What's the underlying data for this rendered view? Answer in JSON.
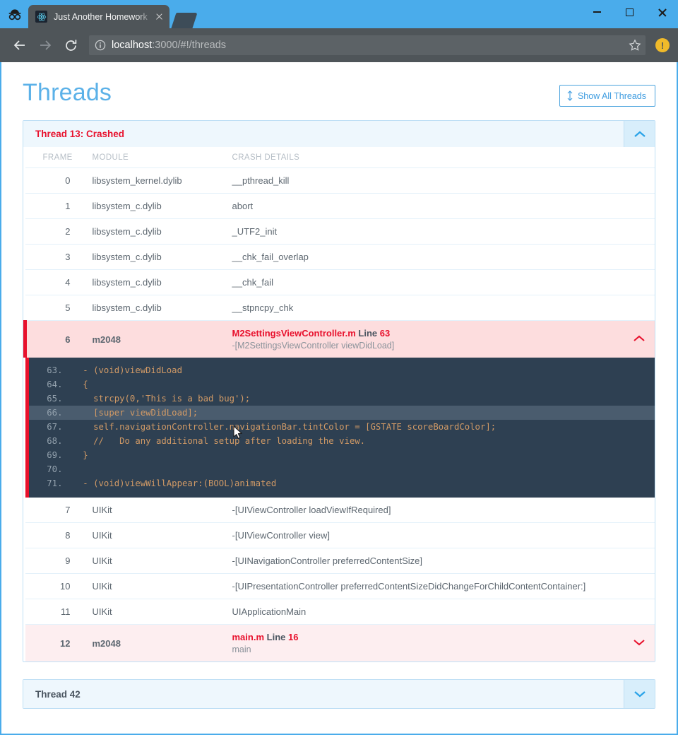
{
  "browser": {
    "incognito_icon": "incognito-hat-icon",
    "tab": {
      "title": "Just Another Homework",
      "favicon": "react-logo-icon",
      "close_icon": "close-icon"
    },
    "new_tab_icon": "new-tab-icon",
    "window_controls": {
      "minimize": "minimize-icon",
      "maximize": "maximize-icon",
      "close": "close-icon"
    },
    "toolbar": {
      "back_icon": "back-arrow-icon",
      "forward_icon": "forward-arrow-icon",
      "reload_icon": "reload-icon",
      "info_icon": "page-info-icon",
      "url_host": "localhost",
      "url_rest": ":3000/#!/threads",
      "bookmark_icon": "star-icon",
      "menu_badge_icon": "update-alert-icon",
      "menu_badge_glyph": "!"
    }
  },
  "page": {
    "title": "Threads",
    "show_all_button": {
      "label": "Show All Threads",
      "icon": "up-down-arrow-icon"
    }
  },
  "threads": [
    {
      "header": "Thread 13: Crashed",
      "crashed": true,
      "expanded": true,
      "toggle_icon": "chevron-up-icon",
      "columns": {
        "frame": "FRAME",
        "module": "MODULE",
        "details": "CRASH DETAILS"
      },
      "frames": [
        {
          "frame": "0",
          "module": "libsystem_kernel.dylib",
          "details": "__pthread_kill"
        },
        {
          "frame": "1",
          "module": "libsystem_c.dylib",
          "details": "abort"
        },
        {
          "frame": "2",
          "module": "libsystem_c.dylib",
          "details": "_UTF2_init"
        },
        {
          "frame": "3",
          "module": "libsystem_c.dylib",
          "details": "__chk_fail_overlap"
        },
        {
          "frame": "4",
          "module": "libsystem_c.dylib",
          "details": "__chk_fail"
        },
        {
          "frame": "5",
          "module": "libsystem_c.dylib",
          "details": "__stpncpy_chk"
        },
        {
          "frame": "6",
          "module": "m2048",
          "highlight": "crash",
          "file": "M2SettingsViewController.m",
          "line_label": "Line",
          "line_num": "63",
          "symbol": "-[M2SettingsViewController viewDidLoad]",
          "toggle_icon": "chevron-up-icon",
          "code": {
            "highlight_line": "66",
            "lines": [
              {
                "num": "63.",
                "text": "  - (void)viewDidLoad"
              },
              {
                "num": "64.",
                "text": "  {"
              },
              {
                "num": "65.",
                "text": "    strcpy(0,'This is a bad bug');"
              },
              {
                "num": "66.",
                "text": "    [super viewDidLoad];"
              },
              {
                "num": "67.",
                "text": "    self.navigationController.navigationBar.tintColor = [GSTATE scoreBoardColor];"
              },
              {
                "num": "68.",
                "text": "    //   Do any additional setup after loading the view."
              },
              {
                "num": "69.",
                "text": "  }"
              },
              {
                "num": "70.",
                "text": ""
              },
              {
                "num": "71.",
                "text": "  - (void)viewWillAppear:(BOOL)animated"
              }
            ]
          }
        },
        {
          "frame": "7",
          "module": "UIKit",
          "details": "-[UIViewController loadViewIfRequired]"
        },
        {
          "frame": "8",
          "module": "UIKit",
          "details": "-[UIViewController view]"
        },
        {
          "frame": "9",
          "module": "UIKit",
          "details": "-[UINavigationController preferredContentSize]"
        },
        {
          "frame": "10",
          "module": "UIKit",
          "details": "-[UIPresentationController preferredContentSizeDidChangeForChildContentContainer:]"
        },
        {
          "frame": "11",
          "module": "UIKit",
          "details": "UIApplicationMain"
        },
        {
          "frame": "12",
          "module": "m2048",
          "highlight": "crash-last",
          "file": "main.m",
          "line_label": "Line",
          "line_num": "16",
          "symbol": "main",
          "toggle_icon": "chevron-down-icon"
        }
      ]
    },
    {
      "header": "Thread 42",
      "crashed": false,
      "expanded": false,
      "toggle_icon": "chevron-down-icon"
    }
  ],
  "colors": {
    "brand_blue": "#5bb1e8",
    "crash_red": "#e8112d",
    "panel_border": "#bfdff5",
    "code_bg": "#2e4052",
    "code_text": "#d19a66",
    "chrome_blue": "#4aaceb"
  }
}
